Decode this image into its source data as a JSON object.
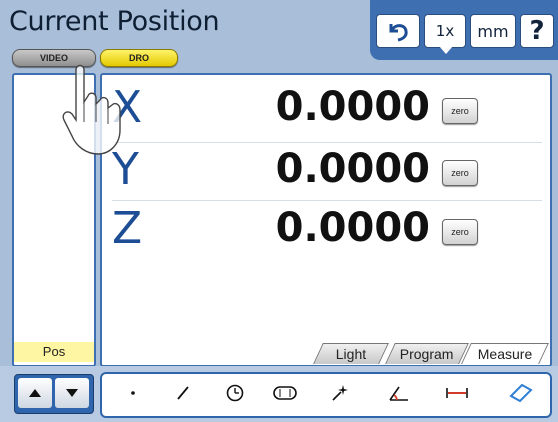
{
  "header": {
    "title": "Current Position",
    "mode_buttons": [
      {
        "label": "VIDEO"
      },
      {
        "label": "DRO"
      }
    ],
    "toolbar": {
      "undo_icon": "undo-icon",
      "zoom_label": "1x",
      "units_label": "mm",
      "help_label": "?"
    }
  },
  "left_panel": {
    "label": "Pos"
  },
  "axes": [
    {
      "letter": "X",
      "value": "0.0000",
      "zero_label": "zero"
    },
    {
      "letter": "Y",
      "value": "0.0000",
      "zero_label": "zero"
    },
    {
      "letter": "Z",
      "value": "0.0000",
      "zero_label": "zero"
    }
  ],
  "tabs": [
    {
      "label": "Light"
    },
    {
      "label": "Program"
    },
    {
      "label": "Measure",
      "active": true
    }
  ],
  "bottom": {
    "nav_icons": [
      "up-arrow-icon",
      "down-arrow-icon"
    ],
    "features": [
      "point-icon",
      "line-icon",
      "circle-icon",
      "slot-icon",
      "auto-measure-icon",
      "angle-icon",
      "distance-icon",
      "rectangle-icon"
    ]
  },
  "colors": {
    "background": "#a9bfd9",
    "accent": "#3e6fb0",
    "axis_letter": "#1d4d94",
    "dro_button": "#f2dd1c",
    "pos_label_bg": "#fff6a4"
  }
}
